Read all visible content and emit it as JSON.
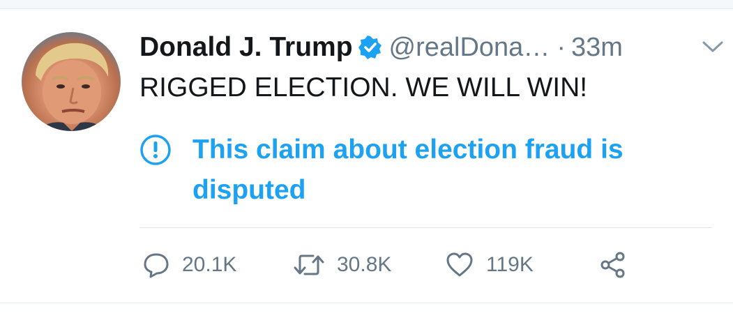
{
  "tweet": {
    "display_name": "Donald J. Trump",
    "handle": "@realDona…",
    "separator": "·",
    "time": "33m",
    "text": "RIGGED ELECTION. WE WILL WIN!",
    "notice": "This claim about election fraud is disputed"
  },
  "actions": {
    "replies": "20.1K",
    "retweets": "30.8K",
    "likes": "119K"
  },
  "icons": {
    "verified": "verified-badge-icon",
    "menu": "chevron-down-icon",
    "notice": "exclamation-circle-icon",
    "reply": "speech-bubble-icon",
    "retweet": "retweet-icon",
    "like": "heart-icon",
    "share": "share-icon"
  },
  "colors": {
    "accent_blue": "#1da1f2",
    "text_primary": "#14171a",
    "text_secondary": "#657786",
    "divider": "#e1e8ed"
  }
}
